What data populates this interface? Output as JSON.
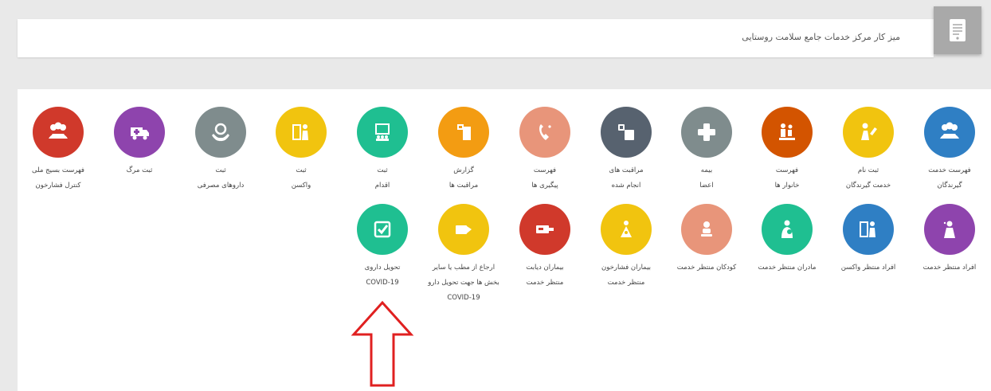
{
  "header": {
    "title": "میز کار مرکز خدمات جامع سلامت روستایی",
    "icon": "document-icon"
  },
  "colors": {
    "blue": "#2f7fc4",
    "yellow": "#f1c40f",
    "orange_dark": "#d35400",
    "gray": "#7f8c8d",
    "slate": "#57626f",
    "salmon": "#e8957a",
    "orange": "#f39c12",
    "teal": "#1fbf91",
    "purple": "#8e44ad",
    "red": "#d0392b",
    "arrow": "#e02020"
  },
  "row1": [
    {
      "lines": [
        "فهرست خدمت",
        "گیرندگان"
      ],
      "icon": "people-icon",
      "color": "#2f7fc4"
    },
    {
      "lines": [
        "ثبت نام",
        "خدمت گیرندگان"
      ],
      "icon": "person-register-icon",
      "color": "#f1c40f"
    },
    {
      "lines": [
        "فهرست",
        "خانوار ها"
      ],
      "icon": "family-icon",
      "color": "#d35400"
    },
    {
      "lines": [
        "بیمه",
        "اعضا"
      ],
      "icon": "plus-icon",
      "color": "#7f8c8d"
    },
    {
      "lines": [
        "مراقبت های",
        "انجام شده"
      ],
      "icon": "care-icon",
      "color": "#57626f"
    },
    {
      "lines": [
        "فهرست",
        "پیگیری ها"
      ],
      "icon": "phone-icon",
      "color": "#e8957a"
    },
    {
      "lines": [
        "گزارش",
        "مراقبت ها"
      ],
      "icon": "report-icon",
      "color": "#f39c12"
    },
    {
      "lines": [
        "ثبت",
        "اقدام"
      ],
      "icon": "action-icon",
      "color": "#1fbf91"
    },
    {
      "lines": [
        "ثبت",
        "واکسن"
      ],
      "icon": "vaccine-icon",
      "color": "#f1c40f"
    },
    {
      "lines": [
        "ثبت",
        "داروهای مصرفی"
      ],
      "icon": "drug-hand-icon",
      "color": "#7f8c8d"
    },
    {
      "lines": [
        "ثبت مرگ"
      ],
      "icon": "ambulance-icon",
      "color": "#8e44ad"
    },
    {
      "lines": [
        "فهرست بسیج ملی",
        "کنترل فشارخون"
      ],
      "icon": "people-icon",
      "color": "#d0392b"
    }
  ],
  "row2": [
    {
      "lines": [
        "افراد منتظر خدمت"
      ],
      "icon": "waiting-person-icon",
      "color": "#8e44ad"
    },
    {
      "lines": [
        "افراد منتظر واکسن"
      ],
      "icon": "vaccine-icon",
      "color": "#2f7fc4"
    },
    {
      "lines": [
        "مادران منتظر خدمت"
      ],
      "icon": "mother-icon",
      "color": "#1fbf91"
    },
    {
      "lines": [
        "کودکان منتظر خدمت"
      ],
      "icon": "child-icon",
      "color": "#e8957a"
    },
    {
      "lines": [
        "بیماران فشارخون",
        "منتظر خدمت"
      ],
      "icon": "pressure-icon",
      "color": "#f1c40f"
    },
    {
      "lines": [
        "بیماران دیابت",
        "منتظر خدمت"
      ],
      "icon": "diabetes-icon",
      "color": "#d0392b"
    },
    {
      "lines": [
        "ارجاع از مطب یا سایر",
        "بخش ها جهت تحویل دارو",
        "COVID-19"
      ],
      "icon": "referral-icon",
      "color": "#f1c40f"
    },
    {
      "lines": [
        "تحویل داروی",
        "COVID-19"
      ],
      "icon": "checkbox-icon",
      "color": "#1fbf91"
    }
  ]
}
